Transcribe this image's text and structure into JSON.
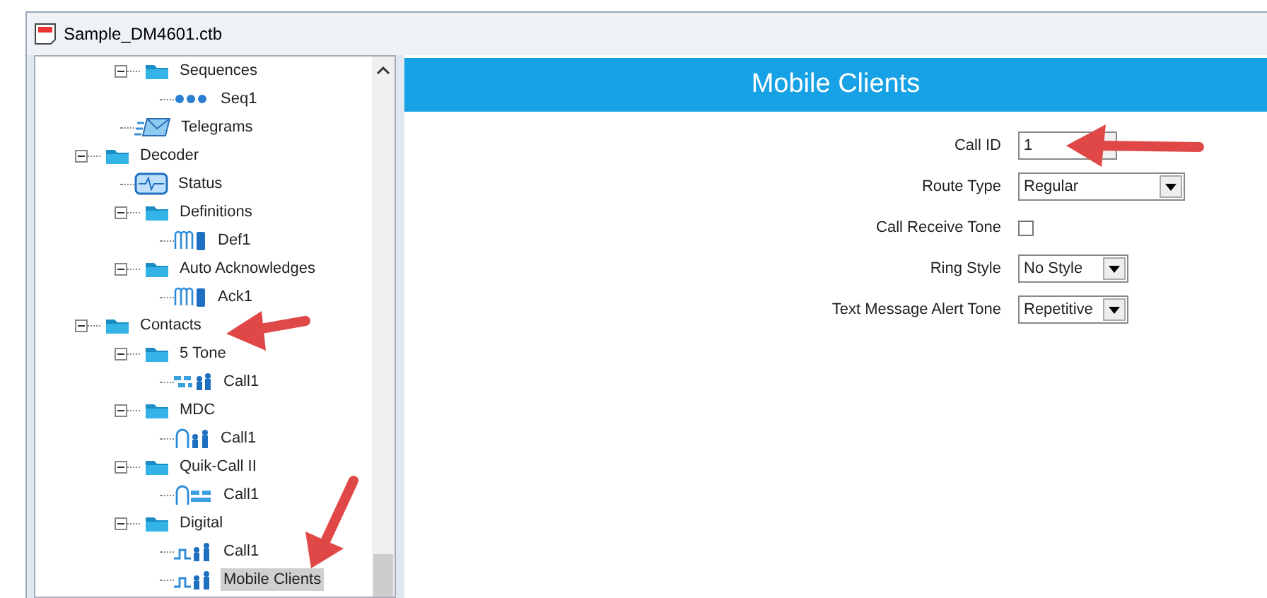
{
  "window": {
    "title": "Sample_DM4601.ctb"
  },
  "tree": [
    {
      "children": [
        {
          "label": "Sequences",
          "kind": "folder",
          "expanded": true,
          "selected": false,
          "children": [
            {
              "label": "Seq1",
              "kind": "sequence",
              "selected": false
            }
          ]
        },
        {
          "label": "Telegrams",
          "kind": "telegram",
          "selected": false
        }
      ]
    },
    {
      "label": "Decoder",
      "kind": "folder",
      "expanded": true,
      "selected": false,
      "children": [
        {
          "label": "Status",
          "kind": "status",
          "selected": false
        },
        {
          "label": "Definitions",
          "kind": "folder",
          "expanded": true,
          "selected": false,
          "children": [
            {
              "label": "Def1",
              "kind": "definition",
              "selected": false
            }
          ]
        },
        {
          "label": "Auto Acknowledges",
          "kind": "folder",
          "expanded": true,
          "selected": false,
          "children": [
            {
              "label": "Ack1",
              "kind": "definition",
              "selected": false
            }
          ]
        }
      ]
    },
    {
      "label": "Contacts",
      "kind": "folder",
      "expanded": true,
      "selected": false,
      "children": [
        {
          "label": "5 Tone",
          "kind": "folder",
          "expanded": true,
          "selected": false,
          "children": [
            {
              "label": "Call1",
              "kind": "five-tone",
              "selected": false
            }
          ]
        },
        {
          "label": "MDC",
          "kind": "folder",
          "expanded": true,
          "selected": false,
          "children": [
            {
              "label": "Call1",
              "kind": "mdc",
              "selected": false
            }
          ]
        },
        {
          "label": "Quik-Call II",
          "kind": "folder",
          "expanded": true,
          "selected": false,
          "children": [
            {
              "label": "Call1",
              "kind": "quik-call",
              "selected": false
            }
          ]
        },
        {
          "label": "Digital",
          "kind": "folder",
          "expanded": true,
          "selected": false,
          "children": [
            {
              "label": "Call1",
              "kind": "digital",
              "selected": false
            },
            {
              "label": "Mobile Clients",
              "kind": "digital",
              "selected": true
            }
          ]
        }
      ]
    }
  ],
  "panel": {
    "title": "Mobile Clients"
  },
  "fields": [
    {
      "label": "Call ID",
      "kind": "spin",
      "value": "1"
    },
    {
      "label": "Route Type",
      "kind": "select",
      "value": "Regular"
    },
    {
      "label": "Call Receive Tone",
      "kind": "checkbox",
      "checked": false
    },
    {
      "label": "Ring Style",
      "kind": "select-small",
      "value": "No Style"
    },
    {
      "label": "Text Message Alert Tone",
      "kind": "select-small",
      "value": "Repetitive"
    }
  ]
}
